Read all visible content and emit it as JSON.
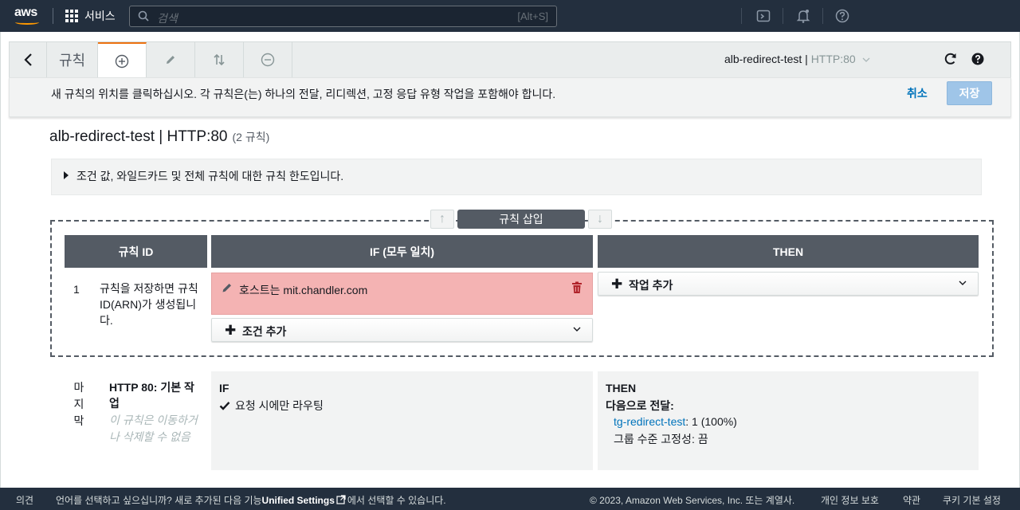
{
  "topnav": {
    "logo": "aws",
    "services_label": "서비스",
    "search_placeholder": "검색",
    "search_shortcut": "[Alt+S]"
  },
  "toolbar": {
    "title": "규칙",
    "context_name": "alb-redirect-test",
    "context_sep": " | ",
    "context_listener": "HTTP:80"
  },
  "banner": {
    "text": "새 규칙의 위치를 클릭하십시오. 각 규칙은(는) 하나의 전달, 리디렉션, 고정 응답 유형 작업을 포함해야 합니다.",
    "cancel": "취소",
    "save": "저장"
  },
  "heading": {
    "title": "alb-redirect-test | HTTP:80",
    "count": "(2 규칙)"
  },
  "limits_text": "조건 값, 와일드카드 및 전체 규칙에 대한 규칙 한도입니다.",
  "insert": {
    "label": "규칙 삽입",
    "up": "↑",
    "down": "↓"
  },
  "columns": {
    "rule_id": "규칙 ID",
    "if": "IF (모두 일치)",
    "then": "THEN"
  },
  "new_rule": {
    "number": "1",
    "id_note": "규칙을 저장하면 규칙 ID(ARN)가 생성됩니다.",
    "condition": "호스트는 mit.chandler.com",
    "add_condition": "조건 추가",
    "add_action": "작업 추가"
  },
  "default_rule": {
    "last_label": "마지막",
    "title": "HTTP 80: 기본 작업",
    "note": "이 규칙은 이동하거나 삭제할 수 없음",
    "if_header": "IF",
    "if_item": "요청 시에만 라우팅",
    "then_header": "THEN",
    "then_sub": "다음으로 전달:",
    "target_group": "tg-redirect-test",
    "target_weight": ": 1 (100%)",
    "stickiness": "그룹 수준 고정성: 끔"
  },
  "footer": {
    "feedback": "의견",
    "language_prefix": "언어를 선택하고 싶으십니까? 새로 추가된 다음 기능",
    "unified_settings": "Unified Settings",
    "language_suffix": "에서 선택할 수 있습니다.",
    "copyright": "© 2023, Amazon Web Services, Inc. 또는 계열사.",
    "privacy": "개인 정보 보호",
    "terms": "약관",
    "cookies": "쿠키 기본 설정"
  }
}
